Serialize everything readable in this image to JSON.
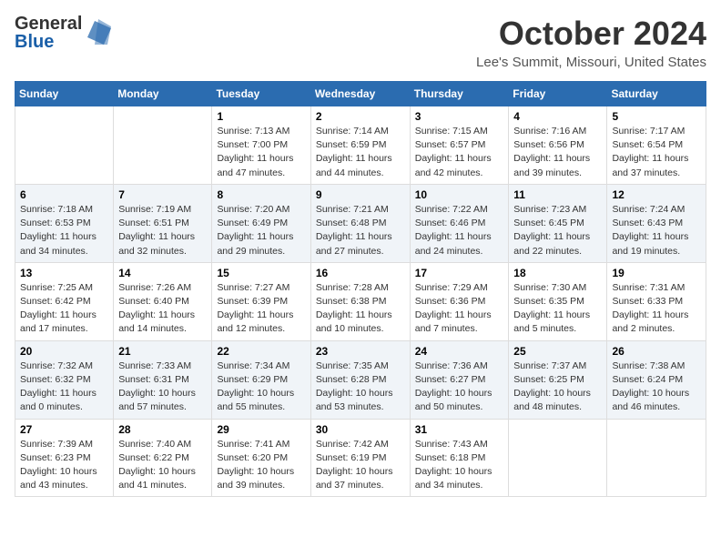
{
  "header": {
    "logo_line1": "General",
    "logo_line2": "Blue",
    "month": "October 2024",
    "location": "Lee's Summit, Missouri, United States"
  },
  "days_of_week": [
    "Sunday",
    "Monday",
    "Tuesday",
    "Wednesday",
    "Thursday",
    "Friday",
    "Saturday"
  ],
  "weeks": [
    {
      "group": "a",
      "days": [
        {
          "num": "",
          "info": ""
        },
        {
          "num": "",
          "info": ""
        },
        {
          "num": "1",
          "info": "Sunrise: 7:13 AM\nSunset: 7:00 PM\nDaylight: 11 hours\nand 47 minutes."
        },
        {
          "num": "2",
          "info": "Sunrise: 7:14 AM\nSunset: 6:59 PM\nDaylight: 11 hours\nand 44 minutes."
        },
        {
          "num": "3",
          "info": "Sunrise: 7:15 AM\nSunset: 6:57 PM\nDaylight: 11 hours\nand 42 minutes."
        },
        {
          "num": "4",
          "info": "Sunrise: 7:16 AM\nSunset: 6:56 PM\nDaylight: 11 hours\nand 39 minutes."
        },
        {
          "num": "5",
          "info": "Sunrise: 7:17 AM\nSunset: 6:54 PM\nDaylight: 11 hours\nand 37 minutes."
        }
      ]
    },
    {
      "group": "b",
      "days": [
        {
          "num": "6",
          "info": "Sunrise: 7:18 AM\nSunset: 6:53 PM\nDaylight: 11 hours\nand 34 minutes."
        },
        {
          "num": "7",
          "info": "Sunrise: 7:19 AM\nSunset: 6:51 PM\nDaylight: 11 hours\nand 32 minutes."
        },
        {
          "num": "8",
          "info": "Sunrise: 7:20 AM\nSunset: 6:49 PM\nDaylight: 11 hours\nand 29 minutes."
        },
        {
          "num": "9",
          "info": "Sunrise: 7:21 AM\nSunset: 6:48 PM\nDaylight: 11 hours\nand 27 minutes."
        },
        {
          "num": "10",
          "info": "Sunrise: 7:22 AM\nSunset: 6:46 PM\nDaylight: 11 hours\nand 24 minutes."
        },
        {
          "num": "11",
          "info": "Sunrise: 7:23 AM\nSunset: 6:45 PM\nDaylight: 11 hours\nand 22 minutes."
        },
        {
          "num": "12",
          "info": "Sunrise: 7:24 AM\nSunset: 6:43 PM\nDaylight: 11 hours\nand 19 minutes."
        }
      ]
    },
    {
      "group": "a",
      "days": [
        {
          "num": "13",
          "info": "Sunrise: 7:25 AM\nSunset: 6:42 PM\nDaylight: 11 hours\nand 17 minutes."
        },
        {
          "num": "14",
          "info": "Sunrise: 7:26 AM\nSunset: 6:40 PM\nDaylight: 11 hours\nand 14 minutes."
        },
        {
          "num": "15",
          "info": "Sunrise: 7:27 AM\nSunset: 6:39 PM\nDaylight: 11 hours\nand 12 minutes."
        },
        {
          "num": "16",
          "info": "Sunrise: 7:28 AM\nSunset: 6:38 PM\nDaylight: 11 hours\nand 10 minutes."
        },
        {
          "num": "17",
          "info": "Sunrise: 7:29 AM\nSunset: 6:36 PM\nDaylight: 11 hours\nand 7 minutes."
        },
        {
          "num": "18",
          "info": "Sunrise: 7:30 AM\nSunset: 6:35 PM\nDaylight: 11 hours\nand 5 minutes."
        },
        {
          "num": "19",
          "info": "Sunrise: 7:31 AM\nSunset: 6:33 PM\nDaylight: 11 hours\nand 2 minutes."
        }
      ]
    },
    {
      "group": "b",
      "days": [
        {
          "num": "20",
          "info": "Sunrise: 7:32 AM\nSunset: 6:32 PM\nDaylight: 11 hours\nand 0 minutes."
        },
        {
          "num": "21",
          "info": "Sunrise: 7:33 AM\nSunset: 6:31 PM\nDaylight: 10 hours\nand 57 minutes."
        },
        {
          "num": "22",
          "info": "Sunrise: 7:34 AM\nSunset: 6:29 PM\nDaylight: 10 hours\nand 55 minutes."
        },
        {
          "num": "23",
          "info": "Sunrise: 7:35 AM\nSunset: 6:28 PM\nDaylight: 10 hours\nand 53 minutes."
        },
        {
          "num": "24",
          "info": "Sunrise: 7:36 AM\nSunset: 6:27 PM\nDaylight: 10 hours\nand 50 minutes."
        },
        {
          "num": "25",
          "info": "Sunrise: 7:37 AM\nSunset: 6:25 PM\nDaylight: 10 hours\nand 48 minutes."
        },
        {
          "num": "26",
          "info": "Sunrise: 7:38 AM\nSunset: 6:24 PM\nDaylight: 10 hours\nand 46 minutes."
        }
      ]
    },
    {
      "group": "a",
      "days": [
        {
          "num": "27",
          "info": "Sunrise: 7:39 AM\nSunset: 6:23 PM\nDaylight: 10 hours\nand 43 minutes."
        },
        {
          "num": "28",
          "info": "Sunrise: 7:40 AM\nSunset: 6:22 PM\nDaylight: 10 hours\nand 41 minutes."
        },
        {
          "num": "29",
          "info": "Sunrise: 7:41 AM\nSunset: 6:20 PM\nDaylight: 10 hours\nand 39 minutes."
        },
        {
          "num": "30",
          "info": "Sunrise: 7:42 AM\nSunset: 6:19 PM\nDaylight: 10 hours\nand 37 minutes."
        },
        {
          "num": "31",
          "info": "Sunrise: 7:43 AM\nSunset: 6:18 PM\nDaylight: 10 hours\nand 34 minutes."
        },
        {
          "num": "",
          "info": ""
        },
        {
          "num": "",
          "info": ""
        }
      ]
    }
  ]
}
